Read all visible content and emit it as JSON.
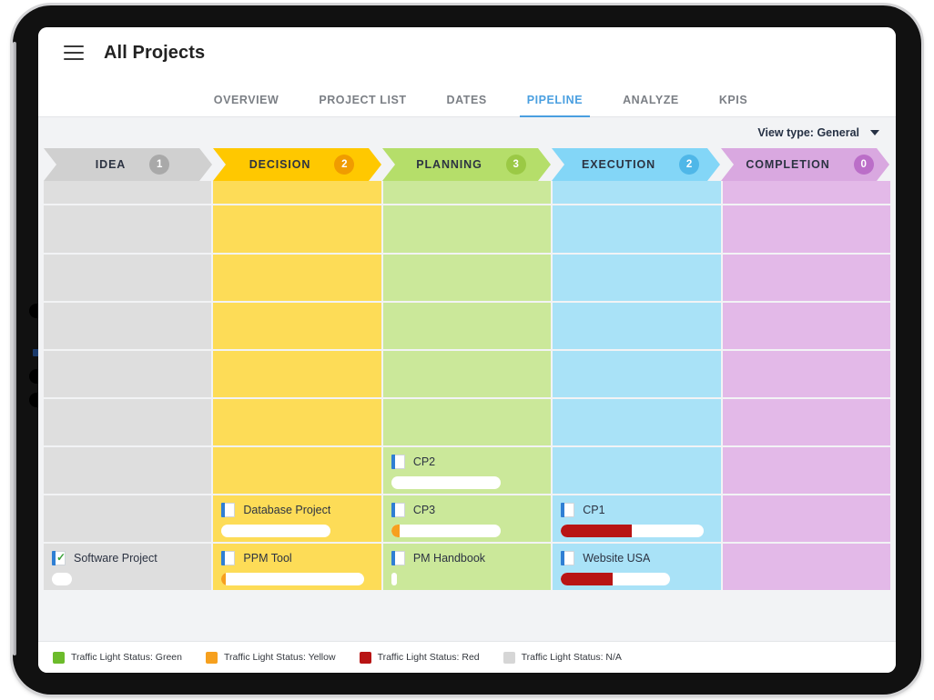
{
  "header": {
    "menu_icon": "hamburger-icon",
    "title": "All Projects"
  },
  "tabs": [
    {
      "label": "OVERVIEW",
      "active": false
    },
    {
      "label": "PROJECT LIST",
      "active": false
    },
    {
      "label": "DATES",
      "active": false
    },
    {
      "label": "PIPELINE",
      "active": true
    },
    {
      "label": "ANALYZE",
      "active": false
    },
    {
      "label": "KPIS",
      "active": false
    }
  ],
  "toolbar": {
    "view_type_label": "View type: General",
    "chevron_icon": "chevron-down-icon"
  },
  "colors": {
    "accent": "#4a9fe0",
    "toolbar_bg": "#f2f3f5",
    "status_green": "#6cbb2b",
    "status_yellow": "#f6a01e",
    "status_red": "#b81414",
    "status_na": "#d6d6d6"
  },
  "pipeline": {
    "stages": [
      {
        "name": "IDEA",
        "count": "1",
        "header_color": "#d0d0d0",
        "badge_color": "#a9a9a9",
        "lane_color": "#dedede",
        "cards": [
          {
            "title": "Software Project",
            "icon": "document-check-icon",
            "progress_pct": 0,
            "progress_color": "#d6d6d6",
            "has_progress": true,
            "dot_only": true
          }
        ]
      },
      {
        "name": "DECISION",
        "count": "2",
        "header_color": "#ffc800",
        "badge_color": "#f09c00",
        "lane_color": "#fddc57",
        "cards": [
          {
            "title": "Database Project",
            "icon": "document-icon",
            "progress_pct": 0,
            "progress_color": "#d6d6d6",
            "has_progress": true,
            "dot_only": false,
            "short_track": true
          },
          {
            "title": "PPM Tool",
            "icon": "document-icon",
            "progress_pct": 3,
            "progress_color": "#f6a01e",
            "has_progress": true,
            "dot_only": false,
            "short_track": false
          }
        ]
      },
      {
        "name": "PLANNING",
        "count": "3",
        "header_color": "#b5de6a",
        "badge_color": "#9bc945",
        "lane_color": "#cbe89a",
        "cards": [
          {
            "title": "CP2",
            "icon": "document-icon",
            "progress_pct": 0,
            "progress_color": "#d6d6d6",
            "has_progress": true,
            "dot_only": false,
            "short_track": true
          },
          {
            "title": "CP3",
            "icon": "document-icon",
            "progress_pct": 8,
            "progress_color": "#f6a01e",
            "has_progress": true,
            "dot_only": false,
            "short_track": true
          },
          {
            "title": "PM Handbook",
            "icon": "document-icon",
            "progress_pct": 0,
            "progress_color": "#d6d6d6",
            "has_progress": true,
            "dot_only": true
          }
        ]
      },
      {
        "name": "EXECUTION",
        "count": "2",
        "header_color": "#83d6f7",
        "badge_color": "#4fb7e8",
        "lane_color": "#a9e2f7",
        "cards": [
          {
            "title": "CP1",
            "icon": "document-icon",
            "progress_pct": 50,
            "progress_color": "#b81414",
            "has_progress": true,
            "dot_only": false,
            "short_track": false
          },
          {
            "title": "Website USA",
            "icon": "document-icon",
            "progress_pct": 47,
            "progress_color": "#b81414",
            "has_progress": true,
            "dot_only": false,
            "short_track": true
          }
        ]
      },
      {
        "name": "COMPLETION",
        "count": "0",
        "header_color": "#d9a8e0",
        "badge_color": "#bb6ec8",
        "lane_color": "#e3b9e8",
        "cards": []
      }
    ]
  },
  "legend": [
    {
      "label": "Traffic Light Status: Green",
      "color": "#6cbb2b"
    },
    {
      "label": "Traffic Light Status: Yellow",
      "color": "#f6a01e"
    },
    {
      "label": "Traffic Light Status: Red",
      "color": "#b81414"
    },
    {
      "label": "Traffic Light Status: N/A",
      "color": "#d6d6d6"
    }
  ]
}
